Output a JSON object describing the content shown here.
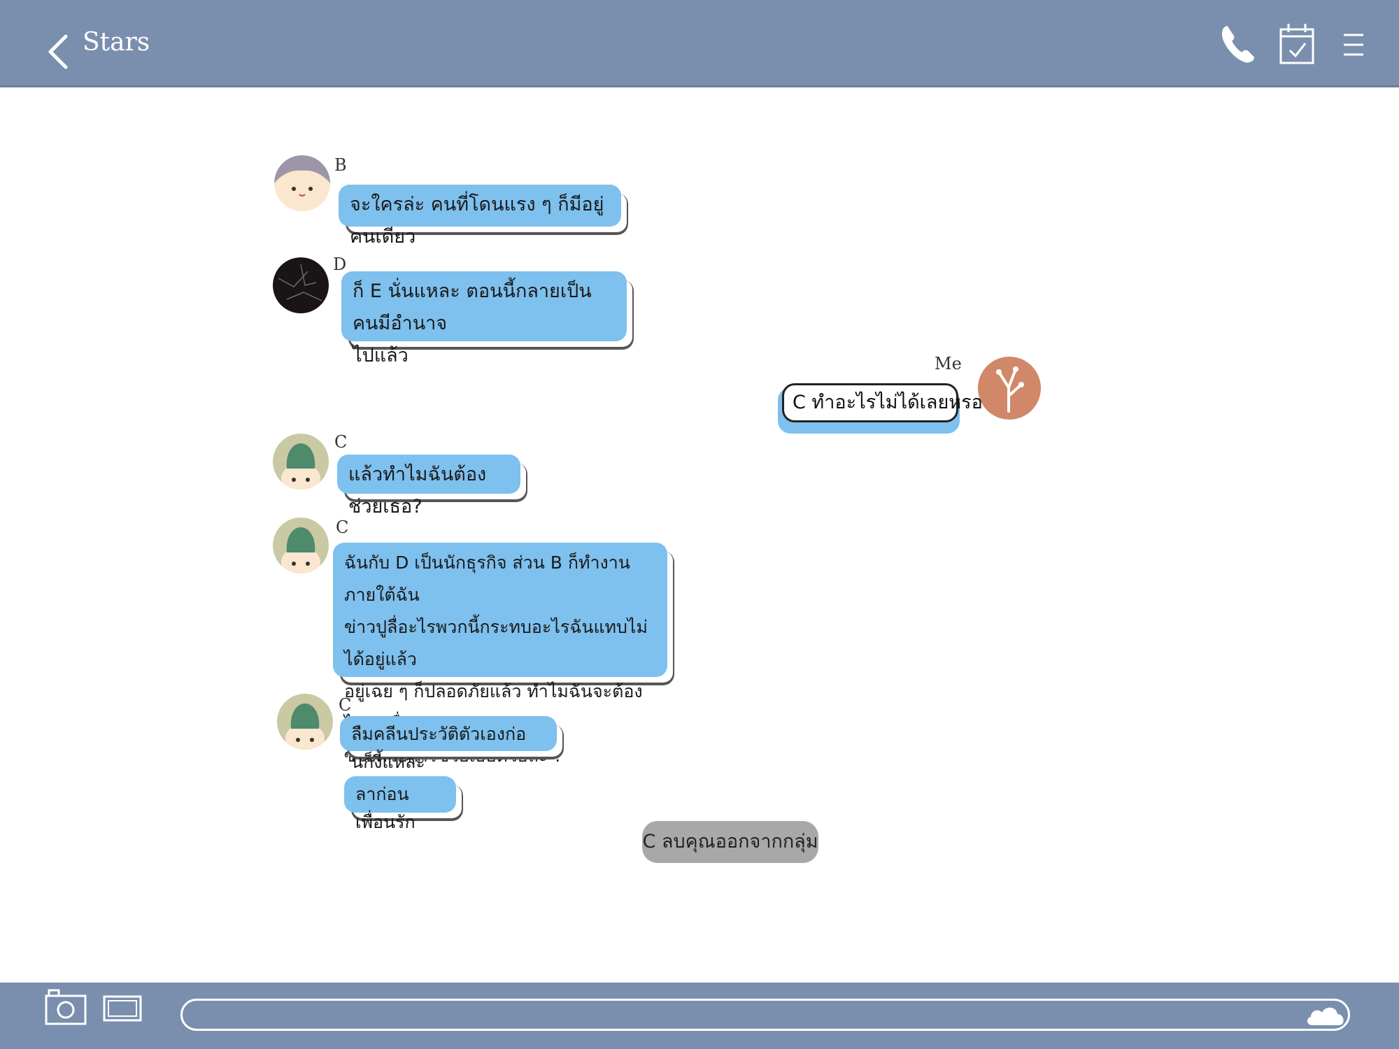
{
  "header": {
    "title": "Stars"
  },
  "messages": [
    {
      "sender": "B",
      "lines": [
        "จะใครล่ะ คนที่โดนแรง ๆ ก็มีอยู่คนเดียว"
      ]
    },
    {
      "sender": "D",
      "lines": [
        "ก็ E นั่นแหละ ตอนนี้กลายเป็นคนมีอำนาจ",
        "ไปแล้ว"
      ]
    },
    {
      "sender": "Me",
      "lines": [
        "C ทำอะไรไม่ได้เลยหรอ"
      ]
    },
    {
      "sender": "C",
      "lines": [
        "แล้วทำไมฉันต้องช่วยเธอ?"
      ]
    },
    {
      "sender": "C",
      "lines": [
        "ฉันกับ D เป็นนักธุรกิจ ส่วน B ก็ทำงานภายใต้ฉัน",
        "ข่าวปูลื่อะไรพวกนี้กระทบอะไรฉันแทบไม่ได้อยู่แล้ว",
        "อยู่เฉย ๆ ก็ปลอดภัยแล้ว ทำไมฉันจะต้องไปหาเรื่อง",
        "ซวยด้วยการช่วยเธอด้วยล่ะ ?"
      ]
    },
    {
      "sender": "C",
      "lines": [
        "ลืมคลีนประวัติตัวเองก่อนก็งี้แหละ"
      ]
    },
    {
      "sender": "",
      "lines": [
        "ลาก่อนเพื่อนรัก"
      ]
    }
  ],
  "system_message": "C ลบคุณออกจากกลุ่ม",
  "composer": {
    "placeholder": ""
  },
  "colors": {
    "bar": "#7a8fad",
    "bubble": "#7ec0ee",
    "system_bubble": "#a8a8a8"
  },
  "icons": [
    "back-icon",
    "phone-icon",
    "calendar-check-icon",
    "menu-icon",
    "camera-icon",
    "image-icon",
    "cloud-icon"
  ]
}
